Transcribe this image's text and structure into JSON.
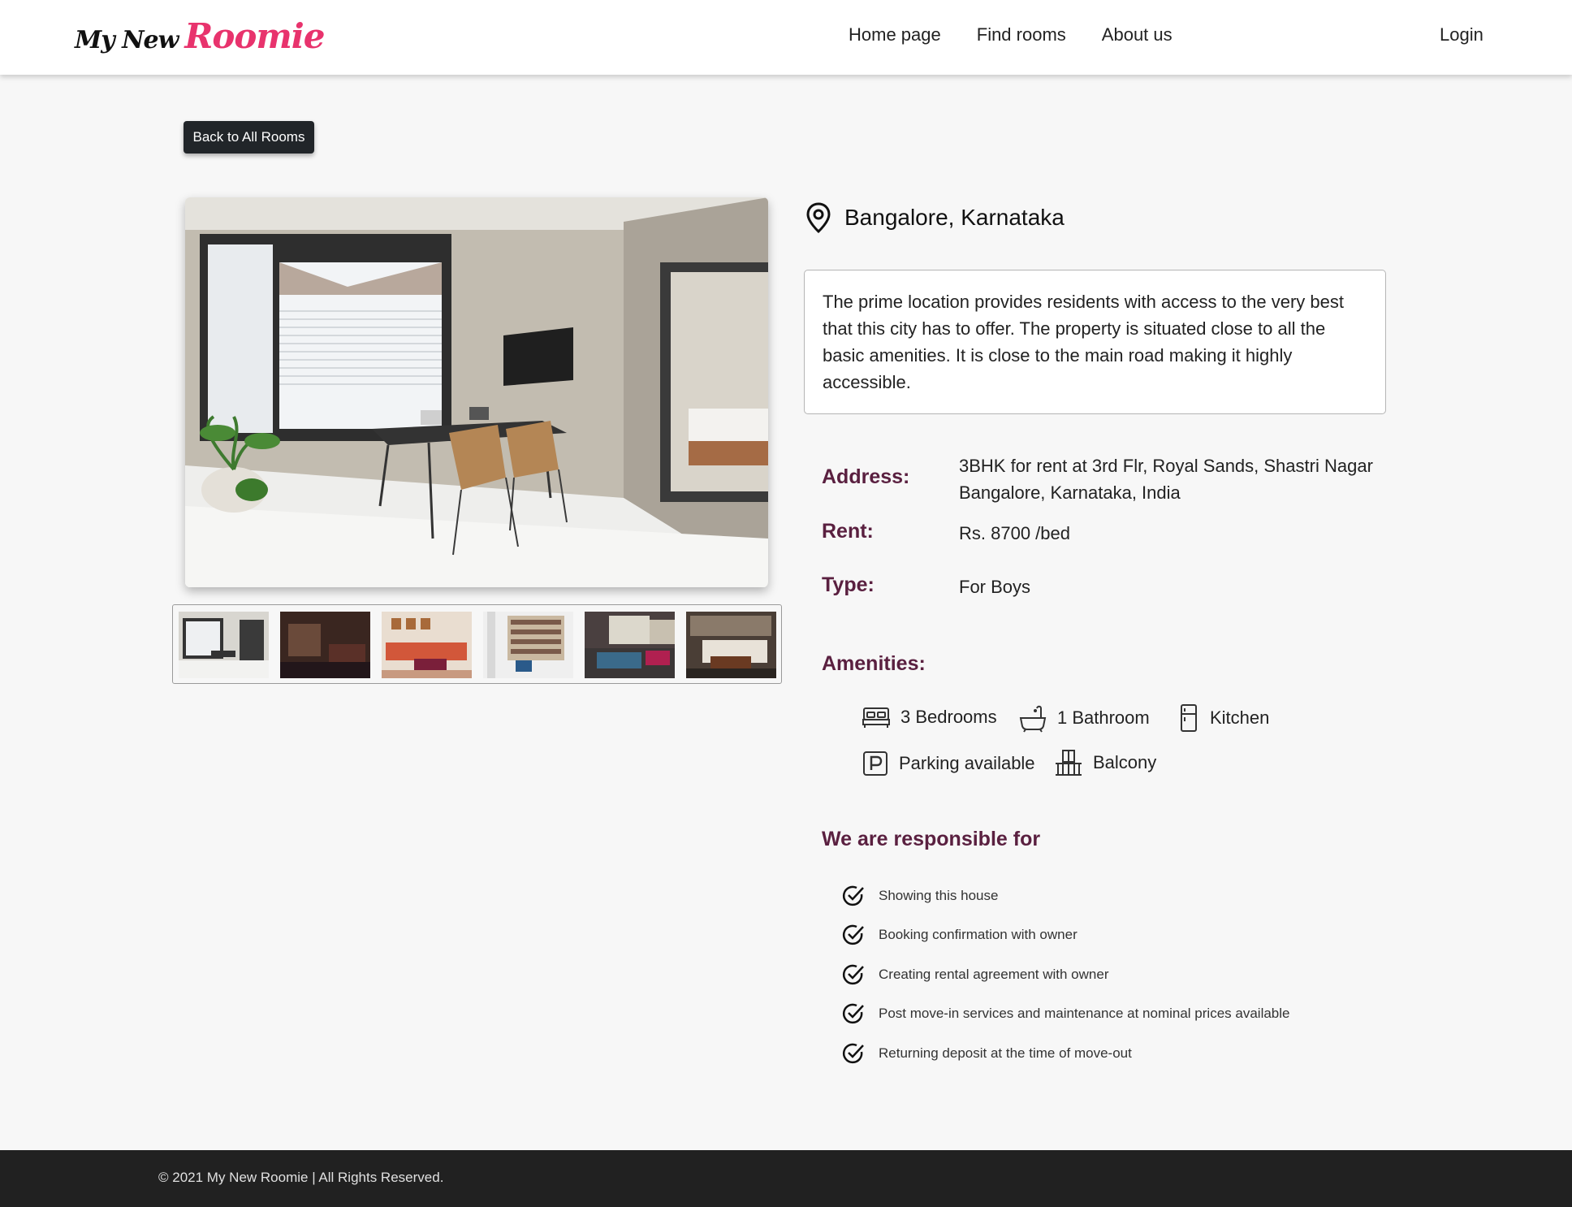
{
  "brand": {
    "part1": "My New",
    "part2": "Roomie",
    "accent": "#e8336d"
  },
  "nav": {
    "links": [
      "Home page",
      "Find rooms",
      "About us"
    ],
    "login": "Login"
  },
  "back_button": "Back to All Rooms",
  "gallery": {
    "thumbnail_count": 6
  },
  "location": {
    "icon": "map-pin-icon",
    "text": "Bangalore, Karnataka"
  },
  "description": "The prime location provides residents with access to the very best that this city has to offer. The property is situated close to all the basic amenities. It is close to the main road making it highly accessible.",
  "details": {
    "address_label": "Address:",
    "address_line1": "3BHK for rent at 3rd Flr, Royal Sands, Shastri Nagar",
    "address_line2": "Bangalore, Karnataka, India",
    "rent_label": "Rent:",
    "rent_value": "Rs. 8700 /bed",
    "type_label": "Type:",
    "type_value": "For Boys"
  },
  "amenities": {
    "title": "Amenities:",
    "items": [
      {
        "icon": "bed-icon",
        "label": "3 Bedrooms"
      },
      {
        "icon": "bathtub-icon",
        "label": "1 Bathroom"
      },
      {
        "icon": "fridge-icon",
        "label": "Kitchen"
      },
      {
        "icon": "parking-icon",
        "label": "Parking available"
      },
      {
        "icon": "balcony-icon",
        "label": "Balcony"
      }
    ]
  },
  "responsibilities": {
    "title": "We are responsible for",
    "items": [
      "Showing this house",
      "Booking confirmation with owner",
      "Creating rental agreement with owner",
      "Post move-in services and maintenance at nominal prices available",
      "Returning deposit at the time of move-out"
    ]
  },
  "footer": "© 2021 My New Roomie | All Rights Reserved.",
  "colors": {
    "label": "#5a2040",
    "footer_bg": "#212121",
    "button_bg": "#212529"
  }
}
